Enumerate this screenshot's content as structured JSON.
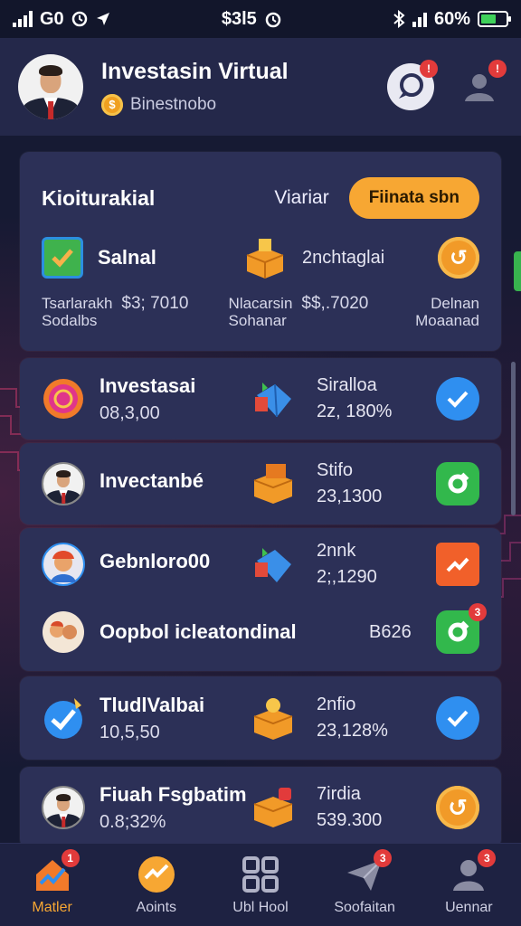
{
  "status_bar": {
    "carrier": "G0",
    "center_text": "$3l5",
    "battery_percent": "60%"
  },
  "header": {
    "title": "Investasin Virtual",
    "subtitle": "Binestnobo",
    "chat_badge": "",
    "profile_badge": ""
  },
  "summary": {
    "title": "Kioiturakial",
    "link": "Viariar",
    "button": "Fiinata sbn",
    "item1_label": "Salnal",
    "item2_label": "2nchtaglai",
    "col1": {
      "line1": "Tsarlarakh",
      "amount": "$3; 7010",
      "line2": "Sodalbs"
    },
    "col2": {
      "line1": "Nlacarsin",
      "amount": "$$,.7020",
      "line2": "Sohanar"
    },
    "col3": {
      "line1": "Delnan",
      "line2": "Moaanad"
    }
  },
  "items": [
    {
      "name": "Investasai",
      "value": "08,3,00",
      "stat_a": "Siralloa",
      "stat_b": "2z, 180%"
    },
    {
      "name": "Invectanbé",
      "value": "",
      "stat_a": "Stifo",
      "stat_b": "23,1300"
    },
    {
      "name": "Gebnloro00",
      "value": "",
      "stat_a": "2nnk",
      "stat_b": "2;,1290"
    },
    {
      "name": "Oopbol icleatondinal",
      "value": "",
      "stat_a": "B626",
      "stat_b": "",
      "action_badge": "3"
    },
    {
      "name": "TludlValbai",
      "value": "10,5,50",
      "stat_a": "2nfio",
      "stat_b": "23,128%"
    },
    {
      "name": "Fiuah Fsgbatim",
      "value": "0.8;32%",
      "stat_a": "7irdia",
      "stat_b": "539.300"
    }
  ],
  "bottom_nav": [
    {
      "label": "Matler",
      "badge": "1"
    },
    {
      "label": "Aoints",
      "badge": ""
    },
    {
      "label": "Ubl Hool",
      "badge": ""
    },
    {
      "label": "Soofaitan",
      "badge": "3"
    },
    {
      "label": "Uennar",
      "badge": "3"
    }
  ],
  "colors": {
    "background": "#161a33",
    "card": "#2c3057",
    "accent_orange": "#f7a733",
    "accent_blue": "#2f8ff0",
    "accent_green": "#32b84c"
  }
}
